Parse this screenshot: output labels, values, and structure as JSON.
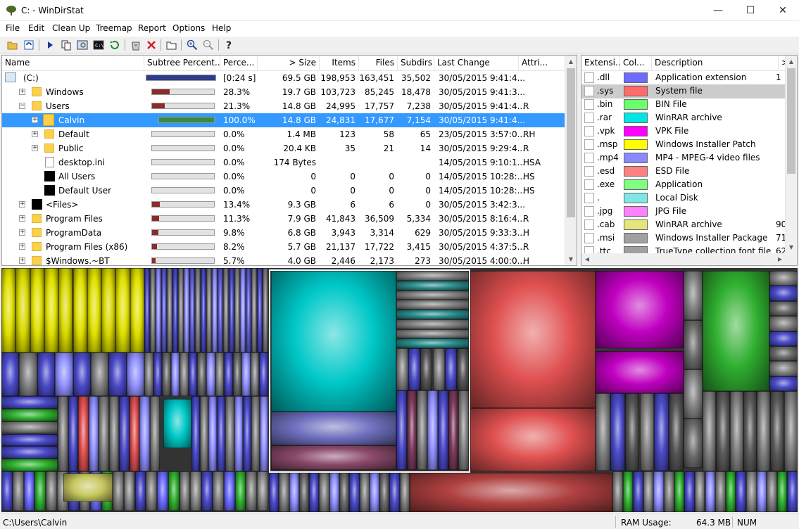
{
  "window": {
    "title": "C: - WinDirStat",
    "minimize": "—",
    "maximize": "☐",
    "close": "✕"
  },
  "menu": [
    "File",
    "Edit",
    "Clean Up",
    "Treemap",
    "Report",
    "Options",
    "Help"
  ],
  "toolbar_icons": [
    "open-icon",
    "refresh-icon",
    "play-icon",
    "copy-icon",
    "explorer-icon",
    "cmd-icon",
    "refresh-selected-icon",
    "recycle-icon",
    "delete-icon",
    "properties-icon",
    "zoom-in-icon",
    "zoom-out-icon",
    "help-icon"
  ],
  "dir_columns": [
    "Name",
    "Subtree Percent...",
    "Perce...",
    "> Size",
    "Items",
    "Files",
    "Subdirs",
    "Last Change",
    "Attri..."
  ],
  "dir_rows": [
    {
      "name": "(C:)",
      "indent": 0,
      "icon": "drive",
      "exp": "",
      "pct": "[0:24 s]",
      "bar": 1.0,
      "barcolor": "#2d3d8a",
      "size": "69.5 GB",
      "items": "198,953",
      "files": "163,451",
      "subdirs": "35,502",
      "change": "30/05/2015  9:41:4...",
      "attr": ""
    },
    {
      "name": "Windows",
      "indent": 1,
      "icon": "folder",
      "exp": "+",
      "pct": "28.3%",
      "bar": 0.283,
      "barcolor": "#8b2b2b",
      "size": "19.7 GB",
      "items": "103,723",
      "files": "85,245",
      "subdirs": "18,478",
      "change": "30/05/2015  9:41:3...",
      "attr": ""
    },
    {
      "name": "Users",
      "indent": 1,
      "icon": "folder",
      "exp": "−",
      "pct": "21.3%",
      "bar": 0.213,
      "barcolor": "#8b2b2b",
      "size": "14.8 GB",
      "items": "24,995",
      "files": "17,757",
      "subdirs": "7,238",
      "change": "30/05/2015  9:41:4...",
      "attr": "R"
    },
    {
      "name": "Calvin",
      "indent": 2,
      "icon": "user",
      "exp": "+",
      "pct": "100.0%",
      "bar": 1.0,
      "barcolor": "#3a8a3a",
      "size": "14.8 GB",
      "items": "24,831",
      "files": "17,677",
      "subdirs": "7,154",
      "change": "30/05/2015  9:41:4...",
      "attr": "",
      "selected": true
    },
    {
      "name": "Default",
      "indent": 2,
      "icon": "folder",
      "exp": "+",
      "pct": "0.0%",
      "bar": 0,
      "barcolor": "#3a8a3a",
      "size": "1.4 MB",
      "items": "123",
      "files": "58",
      "subdirs": "65",
      "change": "23/05/2015  3:57:0...",
      "attr": "RH"
    },
    {
      "name": "Public",
      "indent": 2,
      "icon": "folder",
      "exp": "+",
      "pct": "0.0%",
      "bar": 0,
      "barcolor": "#3a8a3a",
      "size": "20.4 KB",
      "items": "35",
      "files": "21",
      "subdirs": "14",
      "change": "30/05/2015  9:29:4...",
      "attr": "R"
    },
    {
      "name": "desktop.ini",
      "indent": 2,
      "icon": "file",
      "exp": "",
      "pct": "0.0%",
      "bar": 0,
      "barcolor": "#3a8a3a",
      "size": "174 Bytes",
      "items": "",
      "files": "",
      "subdirs": "",
      "change": "14/05/2015  9:10:1...",
      "attr": "HSA"
    },
    {
      "name": "All Users",
      "indent": 2,
      "icon": "black",
      "exp": "",
      "pct": "0.0%",
      "bar": 0,
      "barcolor": "#3a8a3a",
      "size": "0",
      "items": "0",
      "files": "0",
      "subdirs": "0",
      "change": "14/05/2015  10:28:...",
      "attr": "HS"
    },
    {
      "name": "Default User",
      "indent": 2,
      "icon": "black",
      "exp": "",
      "pct": "0.0%",
      "bar": 0,
      "barcolor": "#3a8a3a",
      "size": "0",
      "items": "0",
      "files": "0",
      "subdirs": "0",
      "change": "14/05/2015  10:28:...",
      "attr": "HS"
    },
    {
      "name": "<Files>",
      "indent": 1,
      "icon": "black",
      "exp": "+",
      "pct": "13.4%",
      "bar": 0.134,
      "barcolor": "#8b2b2b",
      "size": "9.3 GB",
      "items": "6",
      "files": "6",
      "subdirs": "0",
      "change": "30/05/2015  3:42:3...",
      "attr": ""
    },
    {
      "name": "Program Files",
      "indent": 1,
      "icon": "folder",
      "exp": "+",
      "pct": "11.3%",
      "bar": 0.113,
      "barcolor": "#8b2b2b",
      "size": "7.9 GB",
      "items": "41,843",
      "files": "36,509",
      "subdirs": "5,334",
      "change": "30/05/2015  8:16:4...",
      "attr": "R"
    },
    {
      "name": "ProgramData",
      "indent": 1,
      "icon": "folder",
      "exp": "+",
      "pct": "9.8%",
      "bar": 0.098,
      "barcolor": "#8b2b2b",
      "size": "6.8 GB",
      "items": "3,943",
      "files": "3,314",
      "subdirs": "629",
      "change": "30/05/2015  9:33:3...",
      "attr": "H"
    },
    {
      "name": "Program Files (x86)",
      "indent": 1,
      "icon": "folder",
      "exp": "+",
      "pct": "8.2%",
      "bar": 0.082,
      "barcolor": "#8b2b2b",
      "size": "5.7 GB",
      "items": "21,137",
      "files": "17,722",
      "subdirs": "3,415",
      "change": "30/05/2015  4:37:5...",
      "attr": "R"
    },
    {
      "name": "$Windows.~BT",
      "indent": 1,
      "icon": "folder",
      "exp": "+",
      "pct": "5.7%",
      "bar": 0.057,
      "barcolor": "#8b2b2b",
      "size": "4.0 GB",
      "items": "2,446",
      "files": "2,173",
      "subdirs": "273",
      "change": "30/05/2015  4:00:0...",
      "attr": "H"
    }
  ],
  "ext_columns": [
    "Extensi...",
    "Col...",
    "Description",
    ">"
  ],
  "ext_rows": [
    {
      "ext": ".dll",
      "color": "#6b6bff",
      "desc": "Application extension",
      "num": "1"
    },
    {
      "ext": ".sys",
      "color": "#ff6b6b",
      "desc": "System file",
      "num": "",
      "selected": true
    },
    {
      "ext": ".bin",
      "color": "#6bff6b",
      "desc": "BIN File",
      "num": ""
    },
    {
      "ext": ".rar",
      "color": "#00e5e5",
      "desc": "WinRAR archive",
      "num": ""
    },
    {
      "ext": ".vpk",
      "color": "#ff00ff",
      "desc": "VPK File",
      "num": ""
    },
    {
      "ext": ".msp",
      "color": "#ffff00",
      "desc": "Windows Installer Patch",
      "num": ""
    },
    {
      "ext": ".mp4",
      "color": "#8a8aff",
      "desc": "MP4 - MPEG-4 video files",
      "num": ""
    },
    {
      "ext": ".esd",
      "color": "#ff8080",
      "desc": "ESD File",
      "num": ""
    },
    {
      "ext": ".exe",
      "color": "#80ff80",
      "desc": "Application",
      "num": ""
    },
    {
      "ext": ".",
      "color": "#80e5e5",
      "desc": "Local Disk",
      "num": ""
    },
    {
      "ext": ".jpg",
      "color": "#ff80ff",
      "desc": "JPG File",
      "num": ""
    },
    {
      "ext": ".cab",
      "color": "#e5e580",
      "desc": "WinRAR archive",
      "num": "90"
    },
    {
      "ext": ".msi",
      "color": "#a0a0a0",
      "desc": "Windows Installer Package",
      "num": "71"
    },
    {
      "ext": ".ttc",
      "color": "#a0a0a0",
      "desc": "TrueType collection font file",
      "num": "62"
    }
  ],
  "status": {
    "path": "C:\\Users\\Calvin",
    "ram_label": "RAM Usage:",
    "ram_value": "64.3 MB",
    "num": "NUM"
  }
}
